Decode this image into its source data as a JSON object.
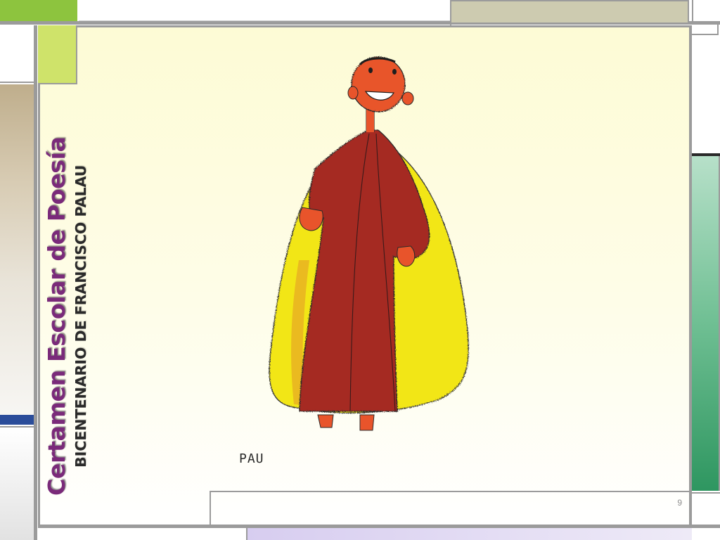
{
  "slide": {
    "title": "Certamen Escolar de Poesía",
    "subtitle": "BICENTENARIO DE FRANCISCO PALAU",
    "number": "9"
  },
  "drawing": {
    "caption": "PAU",
    "subject": "child's crayon drawing of a figure in a brown robe and yellow cape"
  },
  "colors": {
    "title": "#7a2a7a",
    "accent_green": "#c9e263",
    "accent_khaki": "#cdcbb0",
    "accent_tan": "#c2b79a",
    "accent_blue": "#2a4a9a",
    "accent_teal_top": "#b7e0c9",
    "accent_teal_bottom": "#2e9660",
    "frame_gray": "#9b9b9b"
  }
}
